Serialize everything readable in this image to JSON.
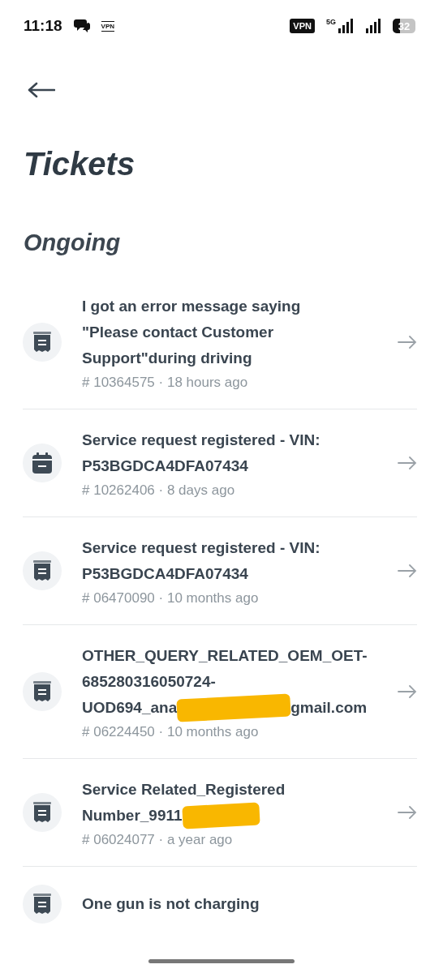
{
  "status_bar": {
    "time": "11:18",
    "notification_vpn": "VPN",
    "vpn_badge": "VPN",
    "network": "5G",
    "battery": "32"
  },
  "title": "Tickets",
  "section": "Ongoing",
  "tickets": [
    {
      "kind": "receipt",
      "title": [
        [
          {
            "text": "I got an error message saying\n\"Please contact Customer\nSupport\"during driving"
          }
        ]
      ],
      "meta": "# 10364575 · 18 hours ago"
    },
    {
      "kind": "calendar",
      "title": [
        [
          {
            "text": "Service request registered - VIN:\nP53BGDCA4DFA07434"
          }
        ]
      ],
      "meta": "# 10262406 · 8 days ago"
    },
    {
      "kind": "receipt",
      "title": [
        [
          {
            "text": "Service request registered - VIN:\nP53BGDCA4DFA07434"
          }
        ]
      ],
      "meta": "# 06470090 · 10 months ago"
    },
    {
      "kind": "receipt",
      "title": [
        [
          {
            "text": "OTHER_QUERY_RELATED_OEM_OET-\n685280316050724-"
          }
        ],
        [
          {
            "text": "UOD694_ana"
          },
          {
            "kind": "redaction"
          },
          {
            "text": "gmail.com"
          }
        ]
      ],
      "meta": "# 06224450 · 10 months ago"
    },
    {
      "kind": "receipt",
      "title": [
        [
          {
            "text": "Service Related_Registered"
          }
        ],
        [
          {
            "text": "Number_9911"
          },
          {
            "kind": "redaction"
          }
        ]
      ],
      "meta": "# 06024077 · a year ago"
    },
    {
      "kind": "receipt",
      "title": [
        [
          {
            "text": "One gun is not charging"
          }
        ]
      ]
    }
  ]
}
